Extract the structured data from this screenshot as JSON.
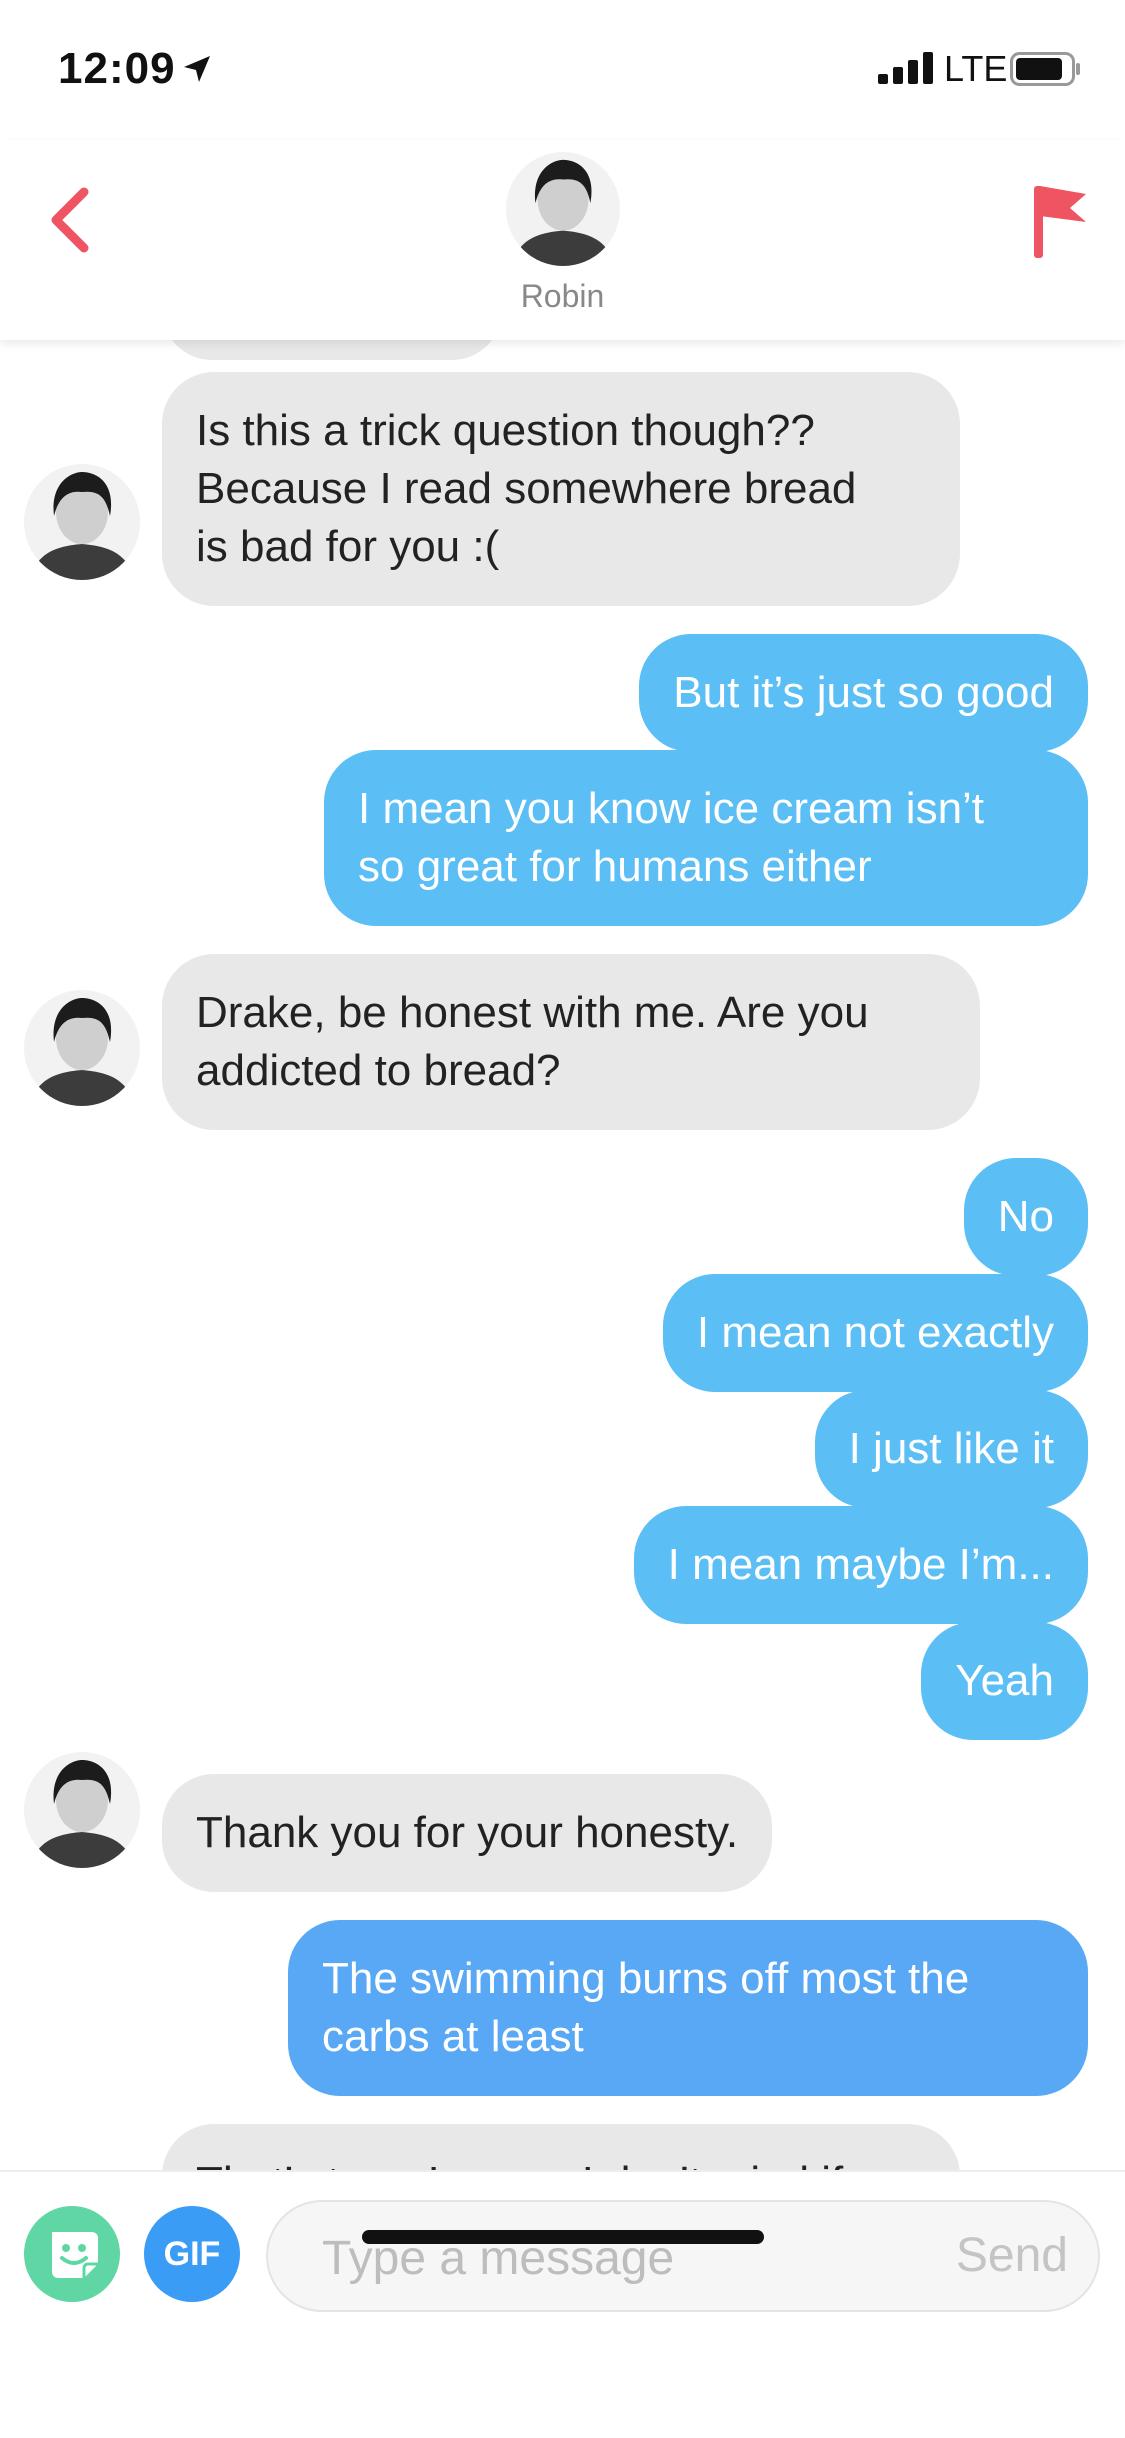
{
  "status_bar": {
    "time": "12:09",
    "network": "LTE"
  },
  "header": {
    "name": "Robin"
  },
  "messages": [
    {
      "from": "them",
      "text": ""
    },
    {
      "from": "them",
      "text": "Is this a trick question though??\nBecause I read somewhere bread\nis bad for you :("
    },
    {
      "from": "me",
      "text": "But it’s just so good"
    },
    {
      "from": "me",
      "text": "I mean you know ice cream isn’t\nso great for humans either"
    },
    {
      "from": "them",
      "text": "Drake, be honest with me. Are you\naddicted to bread?"
    },
    {
      "from": "me",
      "text": "No"
    },
    {
      "from": "me",
      "text": "I mean not exactly"
    },
    {
      "from": "me",
      "text": "I just like it"
    },
    {
      "from": "me",
      "text": "I mean maybe I’m..."
    },
    {
      "from": "me",
      "text": "Yeah"
    },
    {
      "from": "them",
      "text": "Thank you for your honesty."
    },
    {
      "from": "me",
      "text": "The swimming burns off most the\ncarbs at least"
    },
    {
      "from": "them",
      "text": "That’s true. I guess I don’t mind if"
    }
  ],
  "composer": {
    "placeholder": "Type a message",
    "gif_label": "GIF",
    "send_label": "Send"
  },
  "colors": {
    "accent": "#ef5462",
    "bubble_out": "#5bbef5",
    "bubble_in": "#e8e8e8",
    "sticker": "#5fd6a4",
    "gif": "#3b9cf5"
  }
}
